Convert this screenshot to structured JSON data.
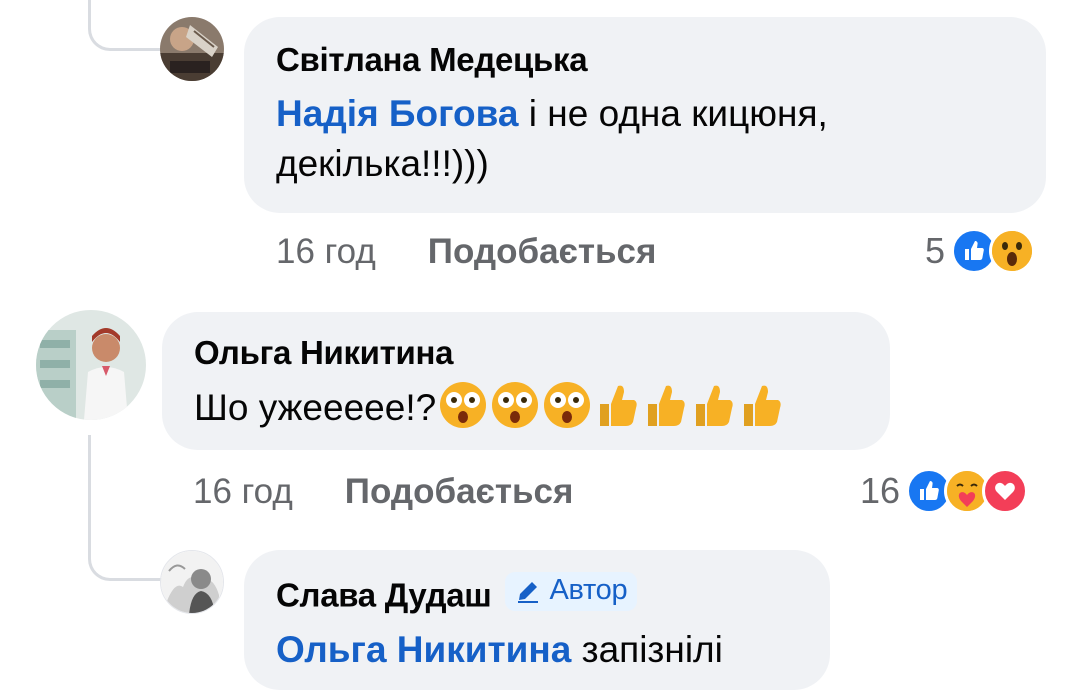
{
  "comments": [
    {
      "author": "Світлана Медецька",
      "mention": "Надія Богова",
      "text_line1": " і не одна кицюня,",
      "text_line2": "декілька!!!)))",
      "time": "16 год",
      "like_label": "Подобається",
      "reaction_count": "5",
      "reactions": [
        "like-icon",
        "wow-icon"
      ]
    },
    {
      "author": "Ольга Никитина",
      "text": "Шо ужееeee!?",
      "emojis": [
        "astonished-face-icon",
        "astonished-face-icon",
        "astonished-face-icon",
        "thumbs-up-icon",
        "thumbs-up-icon",
        "thumbs-up-icon",
        "thumbs-up-icon"
      ],
      "time": "16 год",
      "like_label": "Подобається",
      "reaction_count": "16",
      "reactions": [
        "like-icon",
        "care-icon",
        "love-icon"
      ]
    },
    {
      "author": "Слава Дудаш",
      "badge": "Автор",
      "mention": "Ольга Никитина",
      "text": " запізнілі"
    }
  ],
  "colors": {
    "bubble": "#f0f2f5",
    "mention": "#1660c7",
    "meta": "#65676b",
    "like": "#1877f2",
    "love": "#f33e58",
    "wow": "#f7b125"
  }
}
